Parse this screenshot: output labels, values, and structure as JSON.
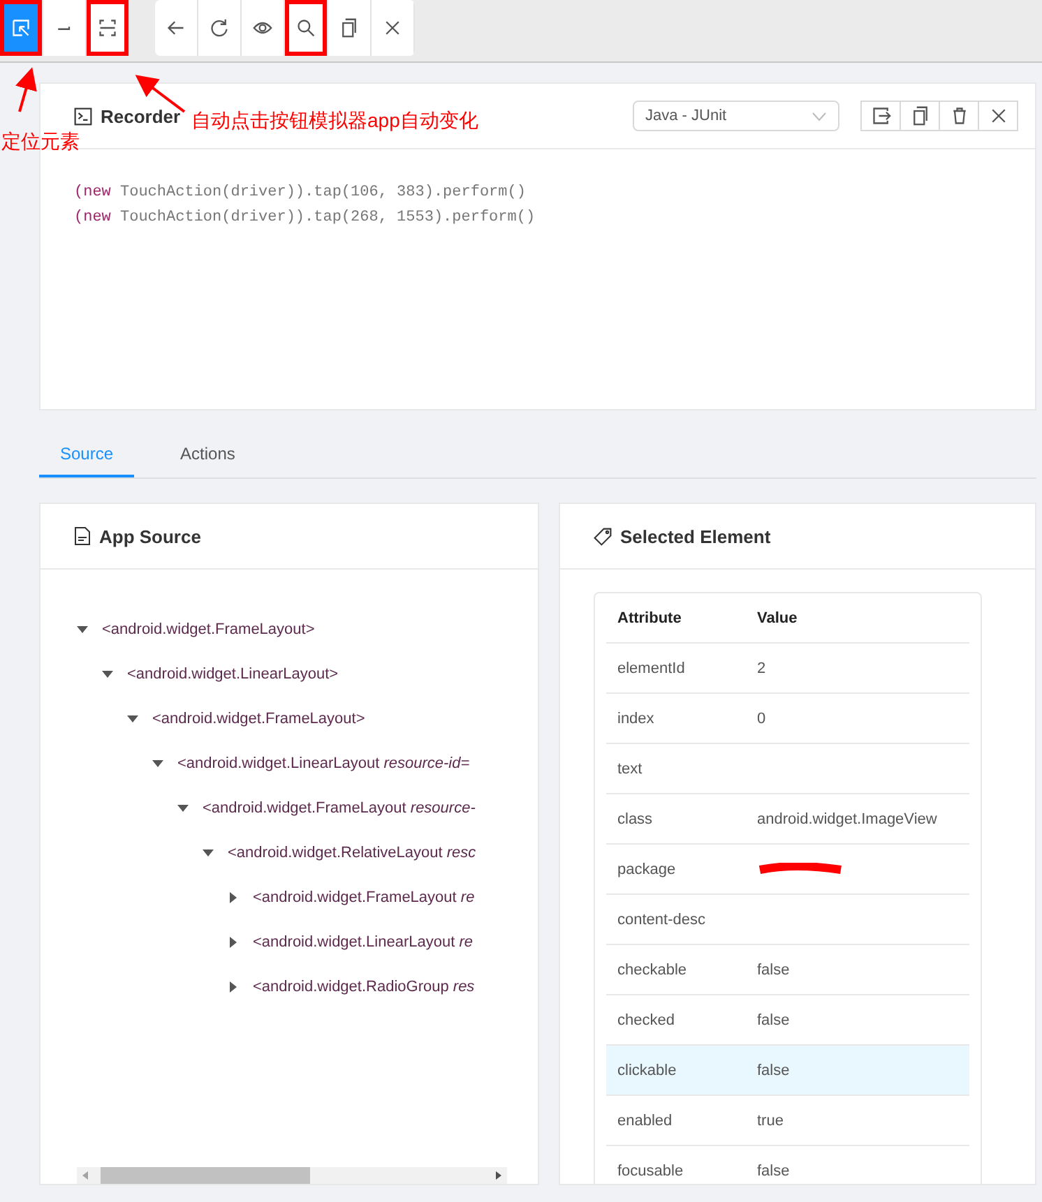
{
  "toolbar": {
    "groups": [
      [
        {
          "selected": true,
          "marked": true
        },
        {
          "selected": false,
          "marked": false
        },
        {
          "selected": false,
          "marked": true
        }
      ],
      [
        {
          "selected": false,
          "marked": false
        },
        {
          "selected": false,
          "marked": false
        },
        {
          "selected": false,
          "marked": false
        },
        {
          "selected": false,
          "marked": true
        },
        {
          "selected": false,
          "marked": false
        },
        {
          "selected": false,
          "marked": false
        }
      ]
    ]
  },
  "annotations": [
    {
      "kind": "left",
      "text": "定位元素"
    },
    {
      "kind": "right",
      "text": "自动点击按钮模拟器app自动变化"
    }
  ],
  "recorder": {
    "title": "Recorder",
    "language": "Java - JUnit",
    "lines": [
      [
        {
          "kind": "keyword",
          "text": "(new"
        },
        {
          "kind": "plain",
          "text": " TouchAction(driver)).tap(106, 383).perform()"
        }
      ],
      [
        {
          "kind": "keyword",
          "text": "(new"
        },
        {
          "kind": "plain",
          "text": " TouchAction(driver)).tap(268, 1553).perform()"
        }
      ]
    ]
  },
  "tabs": [
    {
      "label": "Source",
      "selected": true
    },
    {
      "label": "Actions",
      "selected": false
    }
  ],
  "source": {
    "title": "App Source",
    "tree": [
      {
        "label": "<android.widget.FrameLayout>",
        "expanded": true,
        "children": [
          {
            "label": "<android.widget.LinearLayout>",
            "expanded": true,
            "children": [
              {
                "label": "<android.widget.FrameLayout>",
                "expanded": true,
                "children": [
                  {
                    "label": "<android.widget.LinearLayout *resource-id=*",
                    "expanded": true,
                    "children": [
                      {
                        "label": "<android.widget.FrameLayout *resource-*",
                        "expanded": true,
                        "children": [
                          {
                            "label": "<android.widget.RelativeLayout *resc*",
                            "expanded": true,
                            "children": [
                              {
                                "label": "<android.widget.FrameLayout *re*",
                                "expanded": false
                              },
                              {
                                "label": "<android.widget.LinearLayout *re*",
                                "expanded": false
                              },
                              {
                                "label": "<android.widget.RadioGroup *res*",
                                "expanded": false
                              }
                            ]
                          }
                        ]
                      }
                    ]
                  }
                ]
              }
            ]
          }
        ]
      }
    ]
  },
  "selected_element": {
    "title": "Selected Element",
    "columns": [
      "Attribute",
      "Value"
    ],
    "rows": [
      {
        "attribute": "elementId",
        "value": "2",
        "selected": false
      },
      {
        "attribute": "index",
        "value": "0",
        "selected": false
      },
      {
        "attribute": "text",
        "selected": false
      },
      {
        "attribute": "class",
        "value": "android.widget.ImageView",
        "selected": false
      },
      {
        "attribute": "package",
        "redacted": true,
        "selected": false
      },
      {
        "attribute": "content-desc",
        "selected": false
      },
      {
        "attribute": "checkable",
        "value": "false",
        "selected": false
      },
      {
        "attribute": "checked",
        "value": "false",
        "selected": false
      },
      {
        "attribute": "clickable",
        "value": "false",
        "selected": true
      },
      {
        "attribute": "enabled",
        "value": "true",
        "selected": false
      },
      {
        "attribute": "focusable",
        "value": "false",
        "selected": false
      }
    ]
  }
}
